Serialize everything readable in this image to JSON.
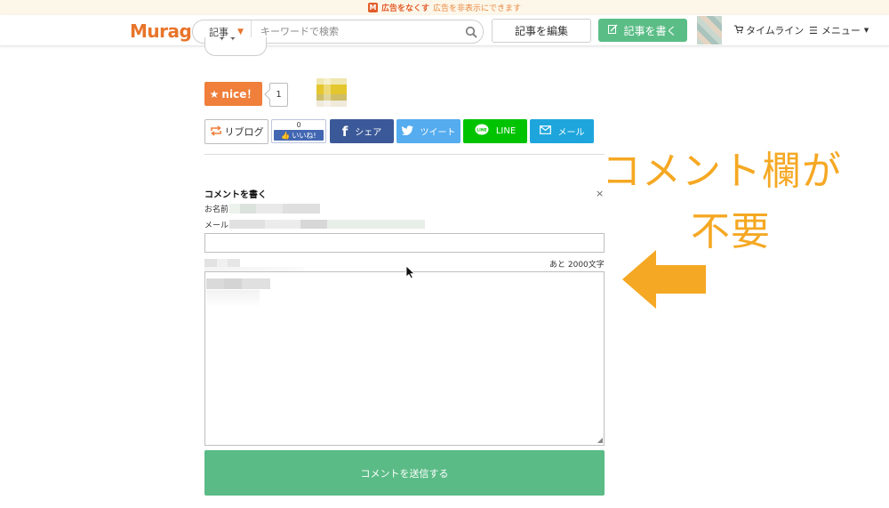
{
  "ad_banner": {
    "link_text": "広告をなくす",
    "sub_text": "広告を非表示にできます"
  },
  "header": {
    "logo_text": "Muragon",
    "search": {
      "category": "記事",
      "placeholder": "キーワードで検索"
    },
    "edit_label": "記事を編集",
    "write_label": "記事を書く",
    "timeline_label": "タイムライン",
    "menu_label": "メニュー"
  },
  "reactions": {
    "nice_label": "nice！",
    "nice_count": "1"
  },
  "share": {
    "reblog_label": "リブログ",
    "fb_like_count": "0",
    "fb_like_label": "いいね!",
    "facebook_label": "シェア",
    "twitter_label": "ツイート",
    "line_label": "LINE",
    "mail_label": "メール"
  },
  "comment_form": {
    "title": "コメントを書く",
    "close_symbol": "×",
    "name_label": "お名前",
    "mail_label": "メール",
    "remaining_text": "あと 2000文字",
    "submit_label": "コメントを送信する"
  },
  "annotation": {
    "line1": "コメント欄が",
    "line2": "不要",
    "color": "#f5a823"
  },
  "colors": {
    "brand_orange": "#e8742a",
    "green_button": "#5bbd86",
    "nice_orange": "#ef7f3a",
    "facebook": "#3b5998",
    "twitter": "#55acee",
    "line": "#00c300",
    "mail": "#1ea6dc"
  }
}
